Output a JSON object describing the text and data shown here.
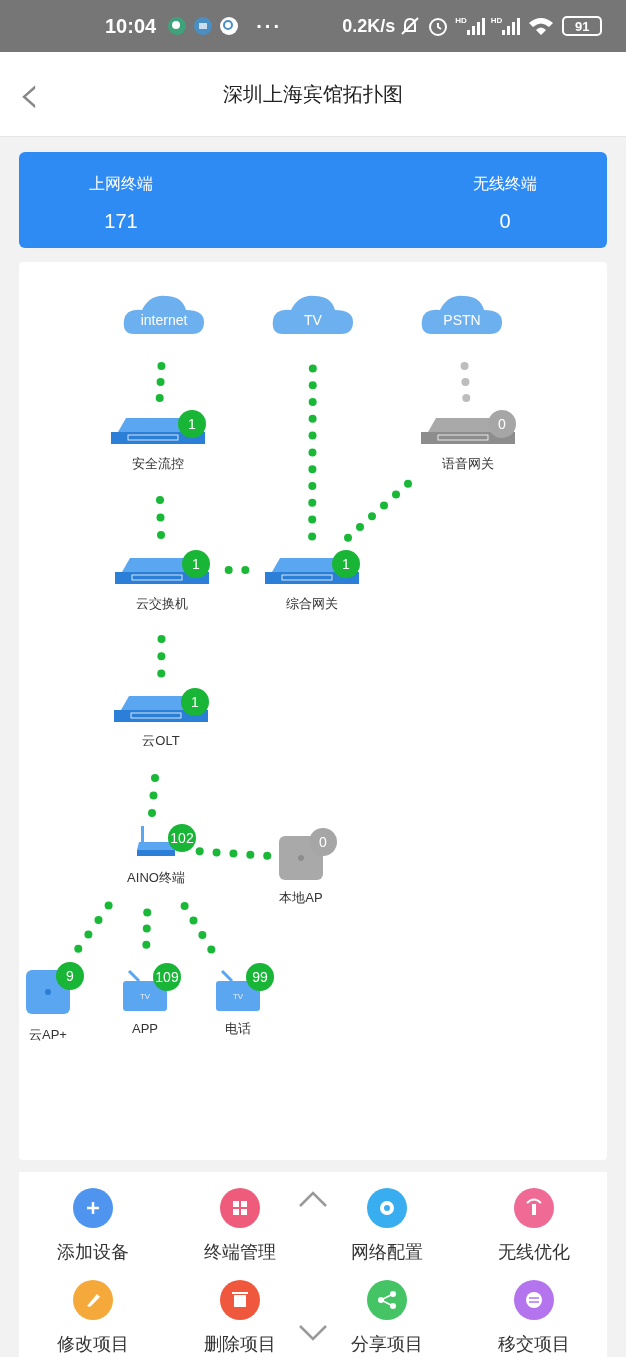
{
  "status_bar": {
    "time": "10:04",
    "more": "···",
    "speed": "0.2K/s",
    "hd": [
      "HD",
      "HD"
    ],
    "battery": "91"
  },
  "header": {
    "back": "‹",
    "title": "深圳上海宾馆拓扑图"
  },
  "summary": [
    {
      "label": "上网终端",
      "value": "171"
    },
    {
      "label": "无线终端",
      "value": "0"
    }
  ],
  "topology": {
    "nodes": [
      {
        "kind": "cloud",
        "label": "internet"
      },
      {
        "kind": "cloud",
        "label": "TV"
      },
      {
        "kind": "cloud",
        "label": "PSTN"
      },
      {
        "kind": "gateway",
        "label": "安全流控",
        "count": "1",
        "online": true
      },
      {
        "kind": "switch",
        "label": "语音网关",
        "count": "0",
        "online": false
      },
      {
        "kind": "switch",
        "label": "云交换机",
        "count": "1",
        "online": true
      },
      {
        "kind": "gateway",
        "label": "综合网关",
        "count": "1",
        "online": true
      },
      {
        "kind": "switch",
        "label": "云OLT",
        "count": "1",
        "online": true
      },
      {
        "kind": "router",
        "label": "AINO终端",
        "count": "102",
        "online": true
      },
      {
        "kind": "ap",
        "label": "本地AP",
        "count": "0",
        "online": false
      },
      {
        "kind": "ap",
        "label": "云AP+",
        "count": "9",
        "online": true
      },
      {
        "kind": "tv",
        "label": "APP",
        "screen_text": "TV",
        "count": "109",
        "online": true
      },
      {
        "kind": "tv",
        "label": "电话",
        "screen_text": "TV",
        "count": "99",
        "online": true
      }
    ],
    "links": [
      {
        "active": true
      },
      {
        "active": true
      },
      {
        "active": false
      },
      {
        "active": true
      },
      {
        "active": true
      },
      {
        "active": true
      },
      {
        "active": true
      },
      {
        "active": true
      },
      {
        "active": true
      },
      {
        "active": true
      },
      {
        "active": true
      },
      {
        "active": true
      }
    ]
  },
  "actions": [
    {
      "label": "添加设备"
    },
    {
      "label": "终端管理"
    },
    {
      "label": "网络配置"
    },
    {
      "label": "无线优化"
    },
    {
      "label": "修改项目"
    },
    {
      "label": "删除项目"
    },
    {
      "label": "分享项目"
    },
    {
      "label": "移交项目"
    }
  ]
}
